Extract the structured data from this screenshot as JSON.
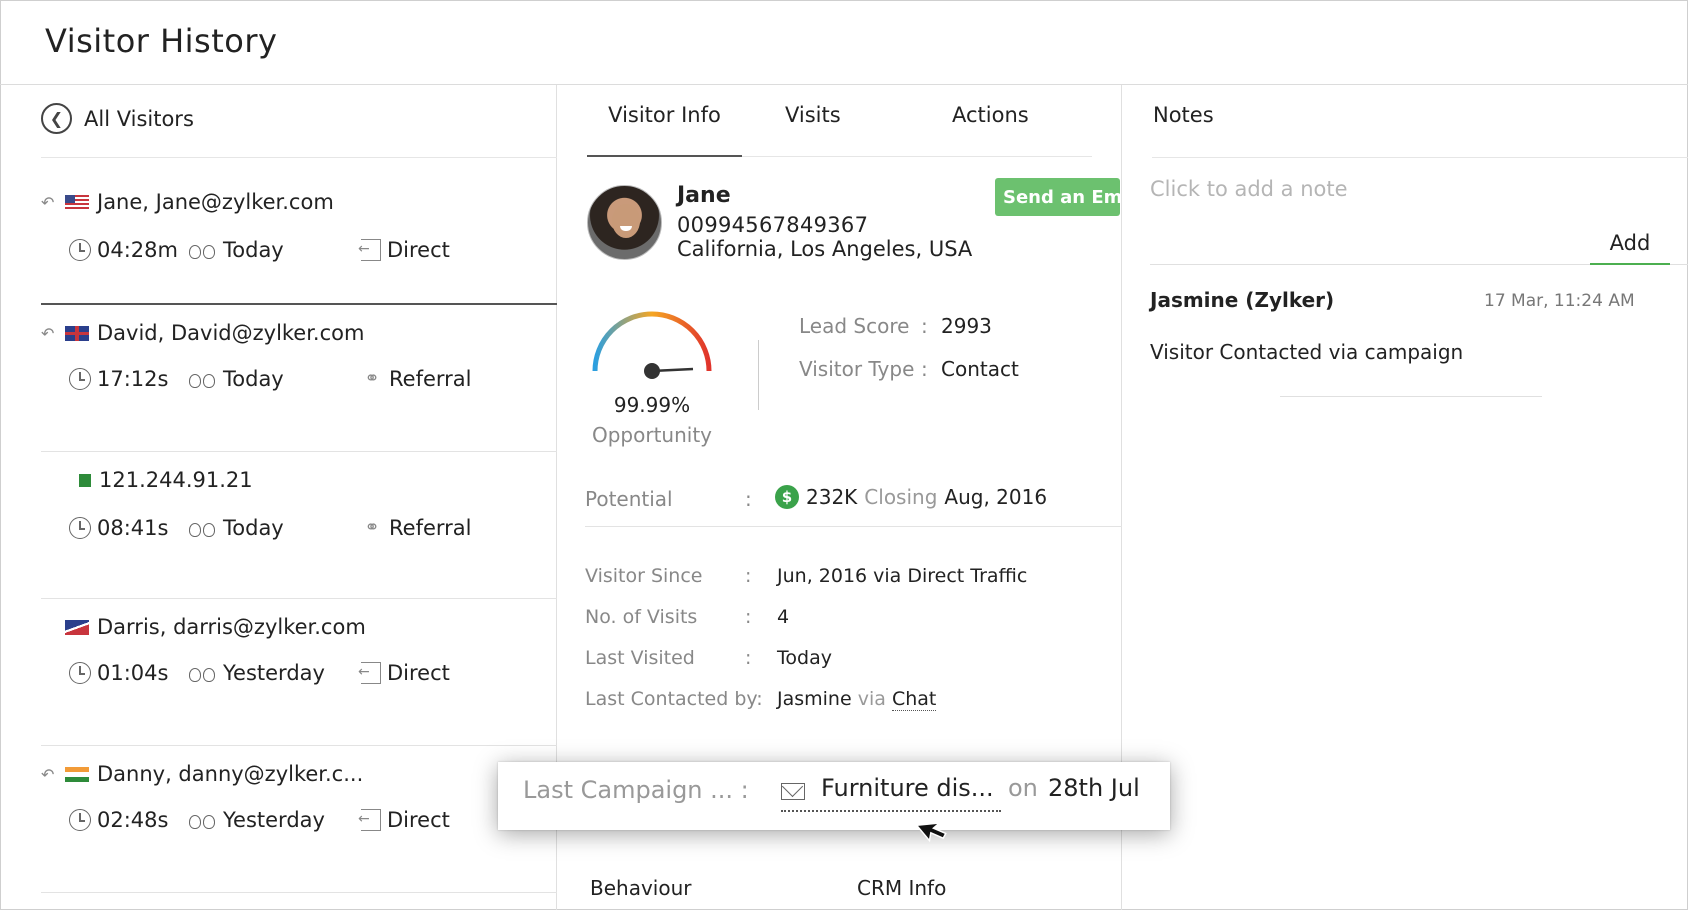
{
  "header": {
    "title": "Visitor History"
  },
  "left": {
    "back_label": "All Visitors",
    "visitors": [
      {
        "name": "Jane, Jane@zylker.com",
        "flag": "us-flag",
        "time": "04:28m",
        "day": "Today",
        "source": "Direct",
        "source_icon": "direct-icon",
        "reply": true
      },
      {
        "name": "David, David@zylker.com",
        "flag": "uk-flag",
        "time": "17:12s",
        "day": "Today",
        "source": "Referral",
        "source_icon": "share-icon",
        "reply": true
      },
      {
        "name": "121.244.91.21",
        "flag": "pk-flag",
        "time": "08:41s",
        "day": "Today",
        "source": "Referral",
        "source_icon": "share-icon",
        "reply": false
      },
      {
        "name": "Darris, darris@zylker.com",
        "flag": "as-flag",
        "time": "01:04s",
        "day": "Yesterday",
        "source": "Direct",
        "source_icon": "direct-icon",
        "reply": false
      },
      {
        "name": "Danny, danny@zylker.c...",
        "flag": "in-flag",
        "time": "02:48s",
        "day": "Yesterday",
        "source": "Direct",
        "source_icon": "direct-icon",
        "reply": true
      }
    ]
  },
  "middle": {
    "tabs": [
      "Visitor Info",
      "Visits",
      "Actions"
    ],
    "profile": {
      "name": "Jane",
      "phone": "00994567849367",
      "location": "California, Los Angeles, USA",
      "send_email_label": "Send an Email"
    },
    "gauge": {
      "value": "99.99%",
      "label": "Opportunity",
      "level": 0.9999
    },
    "lead_score": {
      "label": "Lead Score",
      "colon": ":",
      "value": "2993"
    },
    "visitor_type": {
      "label": "Visitor Type",
      "colon": ":",
      "value": "Contact"
    },
    "potential": {
      "label": "Potential",
      "colon": ":",
      "amount": "232K",
      "closing_word": "Closing",
      "closing_date": "Aug, 2016"
    },
    "info": [
      {
        "label": "Visitor Since",
        "colon": ":",
        "value": "Jun, 2016 via Direct Traffic"
      },
      {
        "label": "No. of Visits",
        "colon": ":",
        "value": "4"
      },
      {
        "label": "Last Visited",
        "colon": ":",
        "value": "Today"
      }
    ],
    "last_contacted": {
      "label": "Last Contacted by:",
      "agent": "Jasmine",
      "via": "via",
      "channel": "Chat"
    },
    "bottom_tabs": [
      "Behaviour",
      "CRM Info"
    ]
  },
  "popup": {
    "label": "Last Campaign ... :",
    "campaign": "Furniture dis...",
    "on_word": "on",
    "date": "28th Jul"
  },
  "notes": {
    "title": "Notes",
    "placeholder": "Click to add a note",
    "add_label": "Add",
    "entries": [
      {
        "author": "Jasmine (Zylker)",
        "time": "17 Mar,  11:24 AM",
        "text": "Visitor Contacted via campaign"
      }
    ]
  },
  "colors": {
    "accent_green": "#6cc16f",
    "add_underline": "#4caf50",
    "dollar_green": "#3aa24a"
  }
}
